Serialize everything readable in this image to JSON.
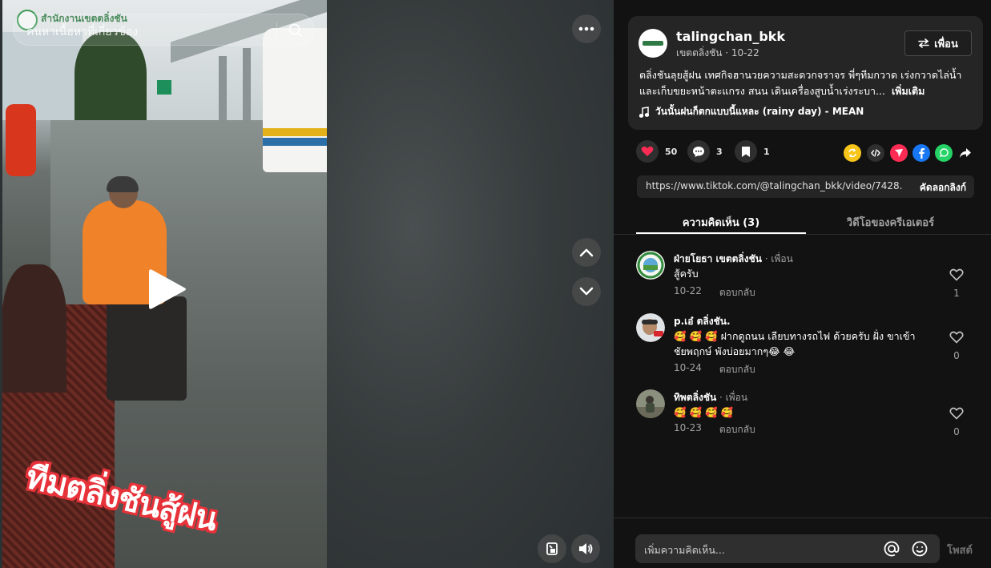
{
  "video": {
    "search_placeholder": "ค้นหาเนื้อหาที่เกี่ยวข้อง",
    "org_watermark": "สำนักงานเขตตลิ่งชัน",
    "overlay_caption": "ทีมตลิ่งชันสู้ฝน",
    "icons": {
      "search": "search-icon",
      "more": "more-dots-icon",
      "play": "play-icon",
      "up": "chevron-up-icon",
      "down": "chevron-down-icon",
      "pip": "picture-in-picture-icon",
      "volume": "volume-icon"
    }
  },
  "post": {
    "author": "talingchan_bkk",
    "author_sub": "เขตตลิ่งชัน · 10-22",
    "friend_button": "เพื่อน",
    "description": "ตลิ่งชันลุยสู้ฝน เทศกิจฮานวยความสะดวกจราจร พี่ๆทีมกวาด เร่งกวาดไล่น้ำและเก็บขยะหน้าตะแกรง สนน เดินเครื่องสูบน้ำเร่งระบา...",
    "more_label": "เพิ่มเติม",
    "music": "วันนั้นฝนก็ตกแบบนี้แหละ (rainy day) - MEAN"
  },
  "stats": {
    "likes": "50",
    "comments": "3",
    "saves": "1"
  },
  "link": {
    "url": "https://www.tiktok.com/@talingchan_bkk/video/7428...",
    "copy_label": "คัดลอกลิงก์"
  },
  "tabs": {
    "comments": "ความคิดเห็น (3)",
    "creator_videos": "วิดีโอของครีเอเตอร์"
  },
  "comments": [
    {
      "name": "ฝ่ายโยธา เขตตลิ่งชัน",
      "badge": " · เพื่อน",
      "text": "สู้ครับ",
      "date": "10-22",
      "reply": "ตอบกลับ",
      "likes": "1"
    },
    {
      "name": "p.เอ๋ ตลิ่งชัน.",
      "badge": "",
      "text": "🥰 🥰 🥰 ฝากดูถนน เลียบทางรถไฟ ด้วยครับ ฝั่ง ขาเข้า ชัยพฤกษ์ พังบ่อยมากๆ😂 😂",
      "date": "10-24",
      "reply": "ตอบกลับ",
      "likes": "0"
    },
    {
      "name": "ทิพตลิ่งชัน",
      "badge": " · เพื่อน",
      "text": "🥰 🥰 🥰 🥰",
      "date": "10-23",
      "reply": "ตอบกลับ",
      "likes": "0"
    }
  ],
  "input": {
    "placeholder": "เพิ่มความคิดเห็น...",
    "post_label": "โพสต์"
  },
  "colors": {
    "like_red": "#fe2c55",
    "panel_bg": "#121212",
    "card_bg": "#252525"
  }
}
